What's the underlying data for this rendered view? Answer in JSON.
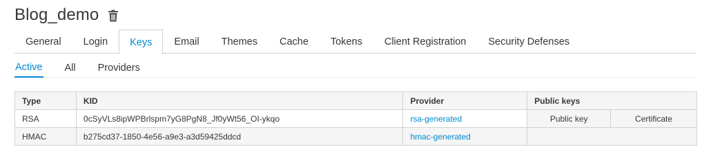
{
  "realm": {
    "title": "Blog_demo",
    "delete_icon": "trash-icon"
  },
  "tabs": [
    {
      "label": "General",
      "active": false
    },
    {
      "label": "Login",
      "active": false
    },
    {
      "label": "Keys",
      "active": true
    },
    {
      "label": "Email",
      "active": false
    },
    {
      "label": "Themes",
      "active": false
    },
    {
      "label": "Cache",
      "active": false
    },
    {
      "label": "Tokens",
      "active": false
    },
    {
      "label": "Client Registration",
      "active": false
    },
    {
      "label": "Security Defenses",
      "active": false
    }
  ],
  "subtabs": [
    {
      "label": "Active",
      "active": true
    },
    {
      "label": "All",
      "active": false
    },
    {
      "label": "Providers",
      "active": false
    }
  ],
  "table": {
    "headers": {
      "type": "Type",
      "kid": "KID",
      "provider": "Provider",
      "public_keys": "Public keys"
    },
    "rows": [
      {
        "type": "RSA",
        "kid": "0cSyVLs8ipWPBrlspm7yG8PgN8_Jf0yWt56_OI-ykqo",
        "provider": "rsa-generated",
        "public_key": "Public key",
        "certificate": "Certificate"
      },
      {
        "type": "HMAC",
        "kid": "b275cd37-1850-4e56-a9e3-a3d59425ddcd",
        "provider": "hmac-generated"
      }
    ]
  },
  "colors": {
    "accent": "#0088ce",
    "text": "#363636",
    "border": "#d1d1d1",
    "header_bg": "#f5f5f5"
  }
}
